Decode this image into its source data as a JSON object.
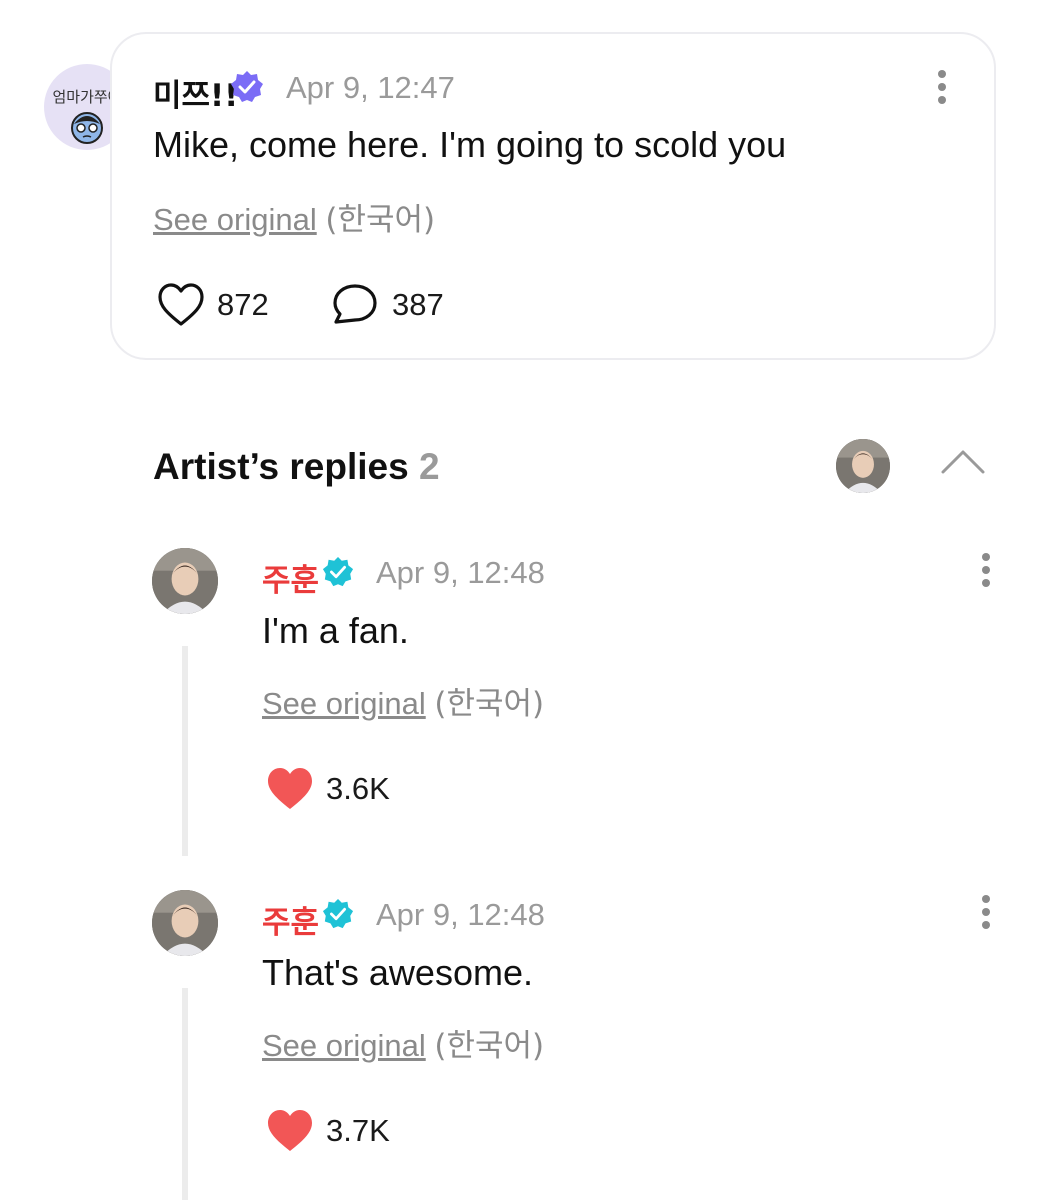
{
  "post": {
    "avatar_text": "엄마가쭈아",
    "author": "미쯔!!",
    "time": "Apr 9, 12:47",
    "text": "Mike, come here. I'm going to scold you",
    "see_original": "See original",
    "language": "(한국어)",
    "likes": "872",
    "comments": "387"
  },
  "artist_replies": {
    "title": "Artist’s replies",
    "count": "2"
  },
  "replies": [
    {
      "author": "주훈",
      "time": "Apr 9, 12:48",
      "text": "I'm a fan.",
      "see_original": "See original",
      "language": "(한국어)",
      "likes": "3.6K"
    },
    {
      "author": "주훈",
      "time": "Apr 9, 12:48",
      "text": "That's awesome.",
      "see_original": "See original",
      "language": "(한국어)",
      "likes": "3.7K"
    }
  ],
  "colors": {
    "artist_name": "#ea3b3b",
    "verified_artist": "#1fc2d6",
    "verified_fan": "#7b6cf6",
    "liked_heart": "#f25656"
  },
  "icons": [
    "more-vertical-icon",
    "heart-outline-icon",
    "comment-icon",
    "verified-badge-icon",
    "chevron-up-icon",
    "heart-filled-icon"
  ]
}
